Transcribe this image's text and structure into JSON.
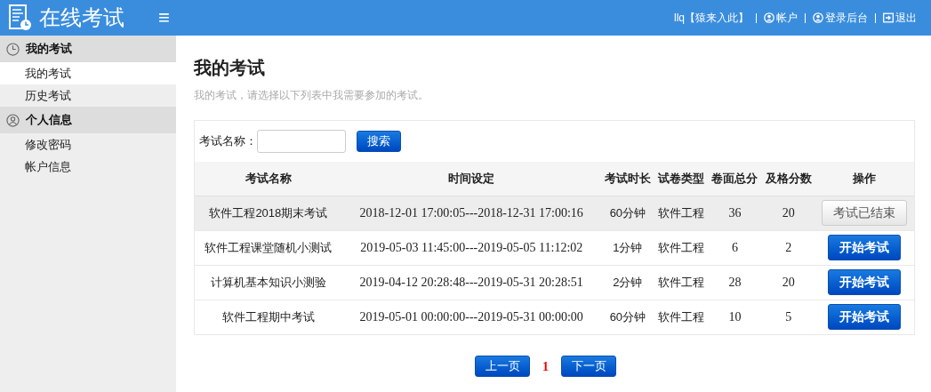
{
  "header": {
    "title": "在线考试",
    "menu_toggle": "≡",
    "user": "llq【猿来入此】",
    "links": [
      {
        "kind": "account",
        "label": "帐户"
      },
      {
        "kind": "admin",
        "label": "登录后台"
      },
      {
        "kind": "logout",
        "label": "退出"
      }
    ]
  },
  "sidebar": {
    "groups": [
      {
        "kind": "clock",
        "label": "我的考试",
        "items": [
          {
            "label": "我的考试",
            "selected": true
          },
          {
            "label": "历史考试",
            "selected": false
          }
        ]
      },
      {
        "kind": "user",
        "label": "个人信息",
        "items": [
          {
            "label": "修改密码",
            "selected": false
          },
          {
            "label": "帐户信息",
            "selected": false
          }
        ]
      }
    ]
  },
  "page": {
    "title": "我的考试",
    "subtitle": "我的考试，请选择以下列表中我需要参加的考试。"
  },
  "search": {
    "label": "考试名称：",
    "button": "搜索"
  },
  "table": {
    "columns": [
      "考试名称",
      "时间设定",
      "考试时长",
      "试卷类型",
      "卷面总分",
      "及格分数",
      "操作"
    ],
    "rows": [
      {
        "highlighted": true,
        "cells": [
          "软件工程2018期末考试",
          "2018-12-01 17:00:05---2018-12-31 17:00:16",
          "60分钟",
          "软件工程",
          "36",
          "20"
        ],
        "action": {
          "kind": "ended",
          "label": "考试已结束"
        }
      },
      {
        "highlighted": false,
        "cells": [
          "软件工程课堂随机小测试",
          "2019-05-03 11:45:00---2019-05-05 11:12:02",
          "1分钟",
          "软件工程",
          "6",
          "2"
        ],
        "action": {
          "kind": "start",
          "label": "开始考试"
        }
      },
      {
        "highlighted": false,
        "cells": [
          "计算机基本知识小测验",
          "2019-04-12 20:28:48---2019-05-31 20:28:51",
          "2分钟",
          "软件工程",
          "28",
          "20"
        ],
        "action": {
          "kind": "start",
          "label": "开始考试"
        }
      },
      {
        "highlighted": false,
        "cells": [
          "软件工程期中考试",
          "2019-05-01 00:00:00---2019-05-31 00:00:00",
          "60分钟",
          "软件工程",
          "10",
          "5"
        ],
        "action": {
          "kind": "start",
          "label": "开始考试"
        }
      }
    ]
  },
  "pagination": {
    "prev": "上一页",
    "current": "1",
    "next": "下一页"
  }
}
